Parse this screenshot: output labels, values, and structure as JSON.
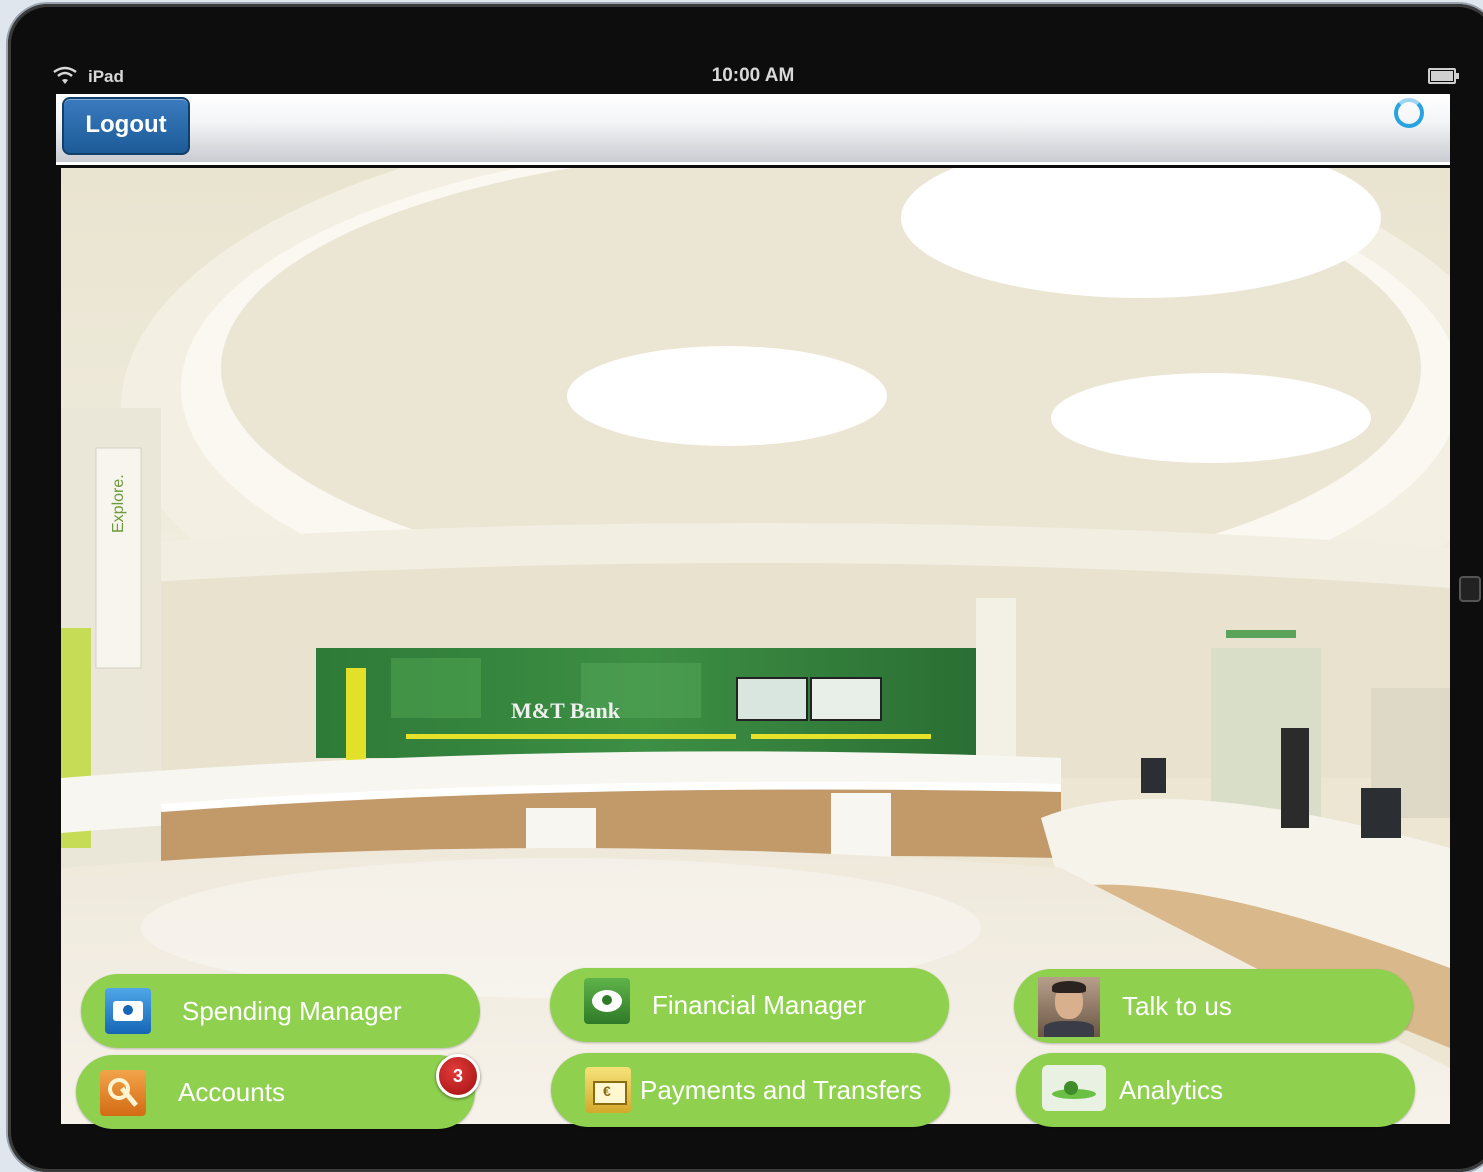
{
  "status_bar": {
    "carrier": "iPad",
    "time": "10:00 AM",
    "wifi_icon": "wifi-icon",
    "battery_icon": "battery-icon"
  },
  "toolbar": {
    "logout_label": "Logout",
    "spinner_icon": "loading-spinner-icon",
    "accent_color": "#1d5b97"
  },
  "hero": {
    "description_icon": "bank-lobby-photo",
    "sign_text": "M&T Bank",
    "banner_text": "Explore."
  },
  "tiles": [
    {
      "id": "spending",
      "label": "Spending Manager",
      "icon": "camera-icon"
    },
    {
      "id": "financial",
      "label": "Financial Manager",
      "icon": "piggy-bank-icon"
    },
    {
      "id": "talk",
      "label": "Talk to us",
      "icon": "advisor-avatar-icon"
    },
    {
      "id": "accounts",
      "label": "Accounts",
      "icon": "key-icon",
      "badge": "3"
    },
    {
      "id": "payments",
      "label": "Payments and Transfers",
      "icon": "euro-wallet-icon"
    },
    {
      "id": "analytics",
      "label": "Analytics",
      "icon": "chart-icon"
    }
  ],
  "colors": {
    "tile_green": "#8fd14f",
    "badge_red": "#c41a1a"
  }
}
